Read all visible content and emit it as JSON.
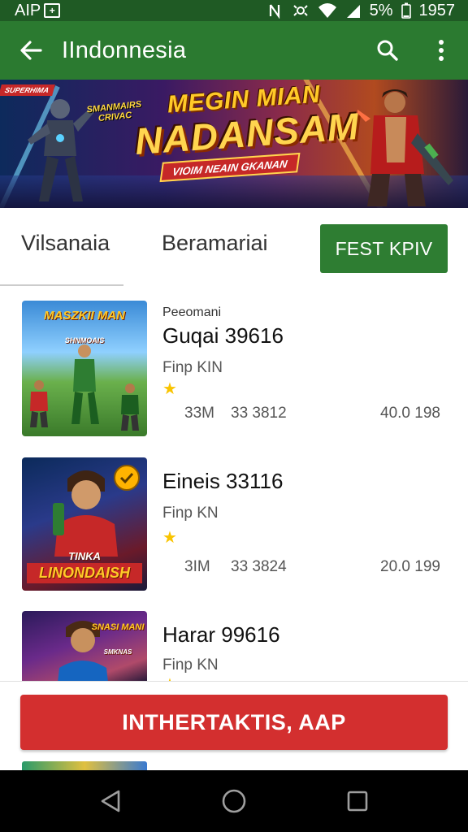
{
  "status_bar": {
    "left_text": "AIP",
    "battery": "5%",
    "time": "1957"
  },
  "app_bar": {
    "title": "IIndonnesia"
  },
  "banner": {
    "corner_tag": "SUPERHIMA",
    "mini_tag": "SMANMAIRS CRIVAC",
    "title_line1": "MEGIN MIAN",
    "title_line2": "NADANSAM",
    "subtitle": "VIOIM NEAIN GKANAN"
  },
  "tabs": {
    "tab1": "Vilsanaia",
    "tab2": "Beramariai",
    "button": "FEST KPIV"
  },
  "items": [
    {
      "kicker": "Peeomani",
      "name": "Guqai 39616",
      "sub": "Finp KIN",
      "star": "★",
      "stat1": "33M",
      "stat2": "33 3812",
      "stat3": "40.0 198",
      "logo": "MASZKII MAN",
      "logo_sub": "SHNMOAIS"
    },
    {
      "kicker": "",
      "name": "Eineis 33116",
      "sub": "Finp KN",
      "star": "★",
      "stat1": "3IM",
      "stat2": "33 3824",
      "stat3": "20.0 199",
      "logo": "TINKA",
      "logo_sub": "LINONDAISH"
    },
    {
      "kicker": "",
      "name": "Harar 99616",
      "sub": "Finp KN",
      "star": "★",
      "logo": "SNASI MANI",
      "logo_sub": "SMKNAS"
    }
  ],
  "cta": {
    "label": "INTHERTAKTIS, AAP"
  },
  "colors": {
    "status_bar": "#1f5a24",
    "app_bar": "#2b7a30",
    "fest_button": "#2e7d32",
    "cta": "#d32f2f",
    "star": "#f9c400"
  },
  "icons": {
    "status": [
      "app-icon",
      "nfc-icon",
      "vibrate-icon",
      "wifi-icon",
      "signal-icon"
    ],
    "app_bar": [
      "back-arrow-icon",
      "search-icon",
      "more-vert-icon"
    ],
    "nav": [
      "back-triangle-icon",
      "home-circle-icon",
      "recents-square-icon"
    ]
  }
}
